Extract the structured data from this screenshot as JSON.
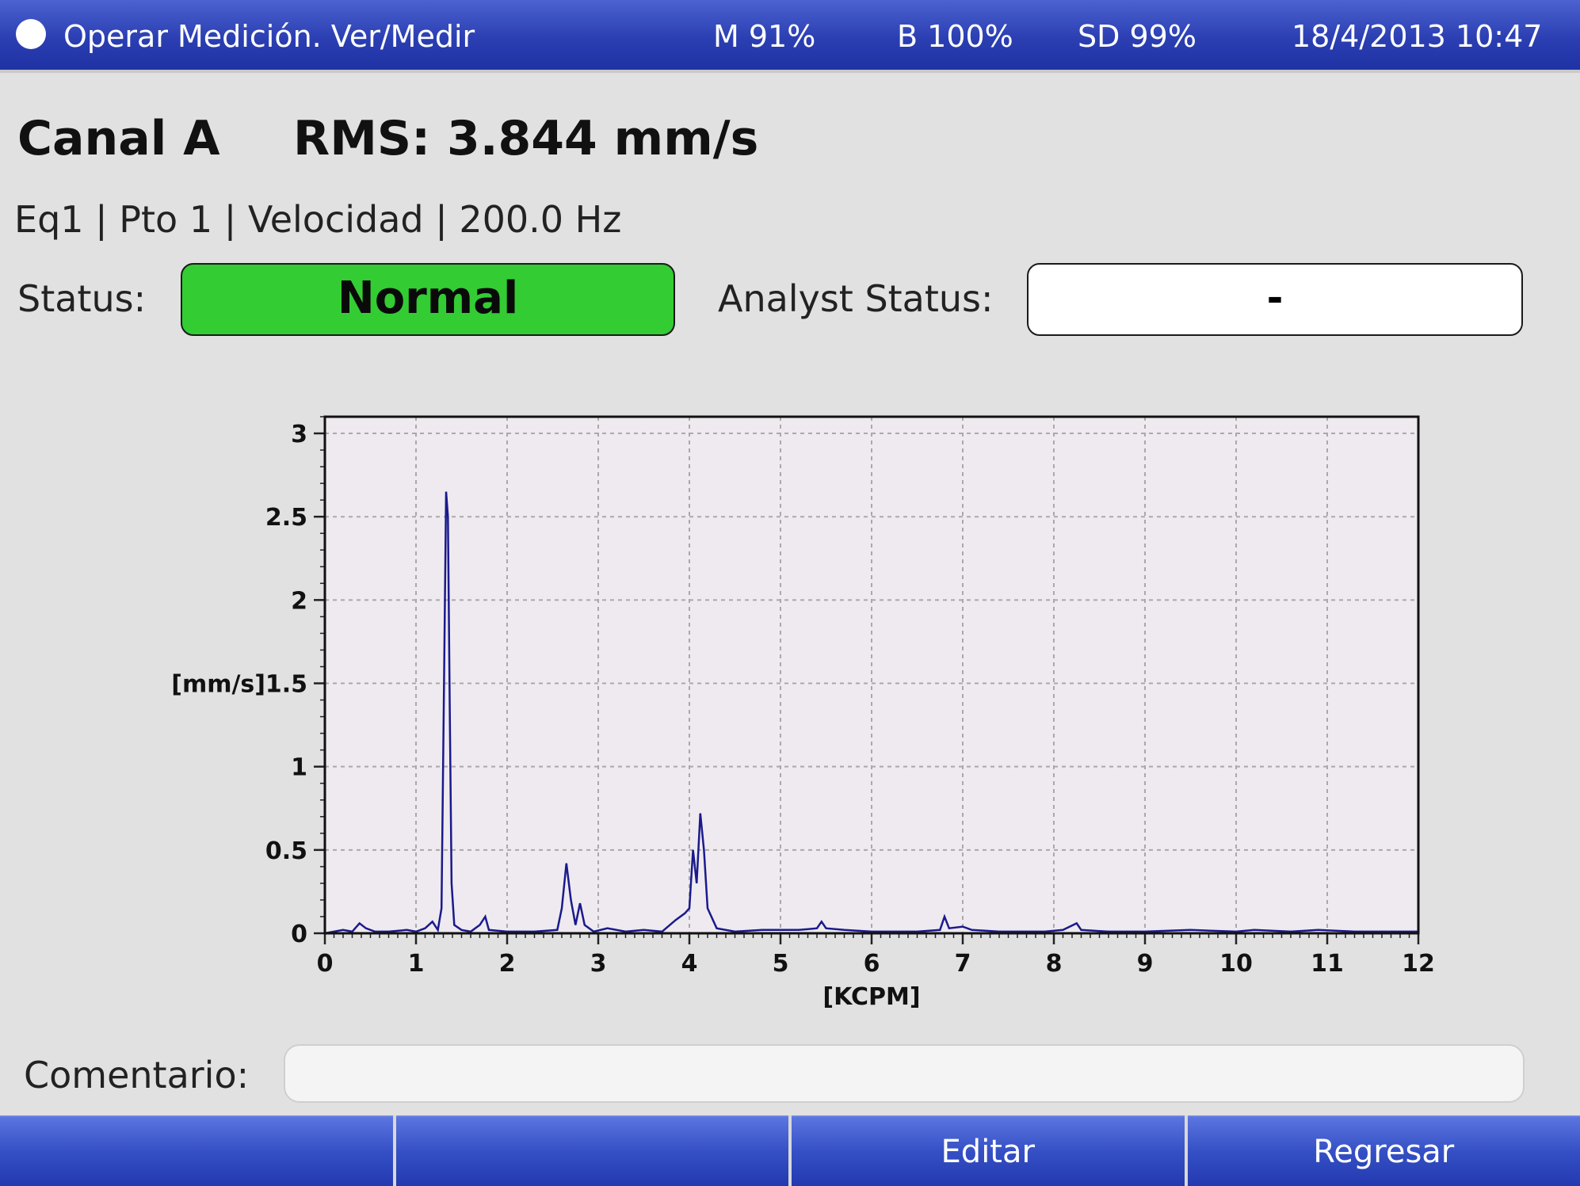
{
  "titlebar": {
    "title": "Operar Medición. Ver/Medir",
    "memory": "M 91%",
    "battery": "B 100%",
    "sd": "SD 99%",
    "datetime": "18/4/2013 10:47"
  },
  "header": {
    "channel": "Canal A",
    "rms": "RMS: 3.844 mm/s",
    "info": "Eq1 | Pto 1 | Velocidad | 200.0 Hz"
  },
  "status": {
    "label": "Status:",
    "value": "Normal",
    "color": "#33cc33",
    "analyst_label": "Analyst Status:",
    "analyst_value": "-"
  },
  "chart_data": {
    "type": "line",
    "xlabel": "[KCPM]",
    "ylabel": "[mm/s]",
    "xlim": [
      0,
      12
    ],
    "ylim": [
      0,
      3.1
    ],
    "xticks": [
      "0",
      "1",
      "2",
      "3",
      "4",
      "5",
      "6",
      "7",
      "8",
      "9",
      "10",
      "11",
      "12"
    ],
    "yticks": [
      "0",
      "0.5",
      "1",
      "1.5",
      "2",
      "2.5",
      "3"
    ],
    "grid": true,
    "line_color": "#1a1a8c",
    "series": [
      {
        "values": [
          [
            0,
            0
          ],
          [
            0.1,
            0.01
          ],
          [
            0.2,
            0.02
          ],
          [
            0.3,
            0.01
          ],
          [
            0.38,
            0.06
          ],
          [
            0.45,
            0.03
          ],
          [
            0.55,
            0.01
          ],
          [
            0.7,
            0.01
          ],
          [
            0.9,
            0.02
          ],
          [
            1.0,
            0.01
          ],
          [
            1.1,
            0.03
          ],
          [
            1.18,
            0.07
          ],
          [
            1.24,
            0.02
          ],
          [
            1.28,
            0.15
          ],
          [
            1.31,
            1.6
          ],
          [
            1.33,
            2.65
          ],
          [
            1.35,
            2.5
          ],
          [
            1.37,
            1.4
          ],
          [
            1.39,
            0.3
          ],
          [
            1.42,
            0.05
          ],
          [
            1.5,
            0.02
          ],
          [
            1.6,
            0.01
          ],
          [
            1.7,
            0.05
          ],
          [
            1.76,
            0.1
          ],
          [
            1.8,
            0.02
          ],
          [
            2.0,
            0.01
          ],
          [
            2.3,
            0.01
          ],
          [
            2.55,
            0.02
          ],
          [
            2.6,
            0.15
          ],
          [
            2.65,
            0.42
          ],
          [
            2.7,
            0.2
          ],
          [
            2.75,
            0.05
          ],
          [
            2.8,
            0.18
          ],
          [
            2.85,
            0.05
          ],
          [
            2.95,
            0.01
          ],
          [
            3.1,
            0.03
          ],
          [
            3.3,
            0.01
          ],
          [
            3.5,
            0.02
          ],
          [
            3.7,
            0.01
          ],
          [
            3.85,
            0.08
          ],
          [
            3.95,
            0.12
          ],
          [
            4.0,
            0.15
          ],
          [
            4.04,
            0.5
          ],
          [
            4.08,
            0.3
          ],
          [
            4.12,
            0.72
          ],
          [
            4.16,
            0.5
          ],
          [
            4.2,
            0.15
          ],
          [
            4.3,
            0.03
          ],
          [
            4.5,
            0.01
          ],
          [
            4.8,
            0.02
          ],
          [
            5.2,
            0.02
          ],
          [
            5.4,
            0.03
          ],
          [
            5.45,
            0.07
          ],
          [
            5.5,
            0.03
          ],
          [
            5.7,
            0.02
          ],
          [
            6.0,
            0.01
          ],
          [
            6.5,
            0.01
          ],
          [
            6.75,
            0.02
          ],
          [
            6.8,
            0.1
          ],
          [
            6.85,
            0.03
          ],
          [
            7.0,
            0.04
          ],
          [
            7.1,
            0.02
          ],
          [
            7.4,
            0.01
          ],
          [
            7.9,
            0.01
          ],
          [
            8.1,
            0.02
          ],
          [
            8.25,
            0.06
          ],
          [
            8.3,
            0.02
          ],
          [
            8.6,
            0.01
          ],
          [
            9.0,
            0.01
          ],
          [
            9.5,
            0.02
          ],
          [
            10.0,
            0.01
          ],
          [
            10.2,
            0.02
          ],
          [
            10.6,
            0.01
          ],
          [
            10.9,
            0.02
          ],
          [
            11.3,
            0.01
          ],
          [
            11.8,
            0.01
          ],
          [
            12,
            0.01
          ]
        ]
      }
    ]
  },
  "comment": {
    "label": "Comentario:",
    "value": ""
  },
  "footer": {
    "buttons": [
      "",
      "",
      "Editar",
      "Regresar"
    ]
  }
}
